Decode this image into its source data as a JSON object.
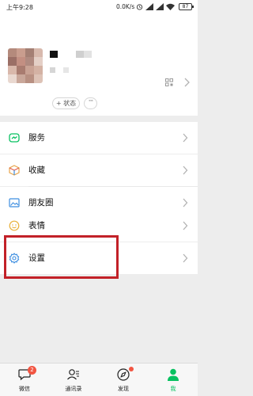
{
  "status_bar": {
    "time": "上午9:28",
    "net_speed": "0.0K/s",
    "battery": "87"
  },
  "profile": {
    "status_label": "+ 状态",
    "more_label": "···"
  },
  "menu": {
    "services": "服务",
    "favorites": "收藏",
    "moments": "朋友圈",
    "stickers": "表情",
    "settings": "设置"
  },
  "tabs": {
    "chats": {
      "label": "微信",
      "badge": "2"
    },
    "contacts": {
      "label": "通讯录"
    },
    "discover": {
      "label": "发现"
    },
    "me": {
      "label": "我"
    }
  },
  "colors": {
    "accent": "#07c160",
    "highlight_box": "#c22128",
    "badge": "#f25542",
    "background": "#ededed"
  }
}
